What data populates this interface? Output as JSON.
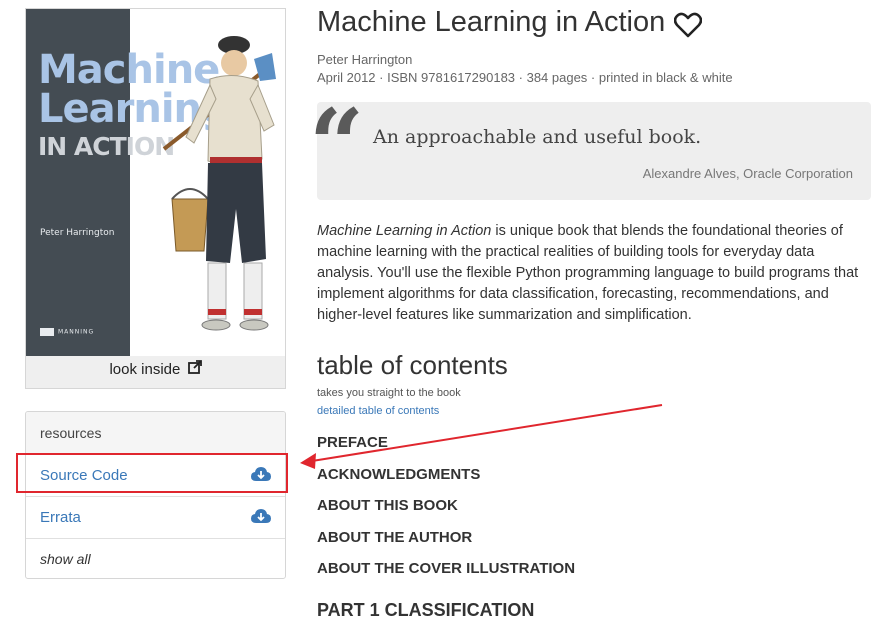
{
  "cover": {
    "title_line1": "Machine",
    "title_line2": "Learning",
    "title_line3": "IN ACTION",
    "author": "Peter Harrington",
    "publisher": "MANNING"
  },
  "look_inside": "look inside",
  "resources": {
    "header": "resources",
    "items": [
      {
        "label": "Source Code",
        "icon": "cloud-download-icon"
      },
      {
        "label": "Errata",
        "icon": "cloud-download-icon"
      }
    ],
    "show_all": "show all"
  },
  "book": {
    "title": "Machine Learning in Action",
    "author": "Peter Harrington",
    "meta": "April 2012 · ISBN 9781617290183 · 384 pages · printed in black & white"
  },
  "quote": {
    "text": "An approachable and useful book.",
    "attribution": "Alexandre Alves, Oracle Corporation"
  },
  "description": {
    "title_italic": "Machine Learning in Action",
    "rest": " is unique book that blends the foundational theories of machine learning with the practical realities of building tools for everyday data analysis. You'll use the flexible Python programming language to build programs that implement algorithms for data classification, forecasting, recommendations, and higher-level features like summarization and simplification."
  },
  "toc": {
    "title": "table of contents",
    "subtitle": "takes you straight to the book",
    "detailed_link": "detailed table of contents",
    "items": [
      "PREFACE",
      "ACKNOWLEDGMENTS",
      "ABOUT THIS BOOK",
      "ABOUT THE AUTHOR",
      "ABOUT THE COVER ILLUSTRATION"
    ],
    "part": "PART 1 CLASSIFICATION"
  },
  "colors": {
    "link": "#3a78b8",
    "annotation": "#e0262e",
    "cover_band": "#444c53"
  }
}
